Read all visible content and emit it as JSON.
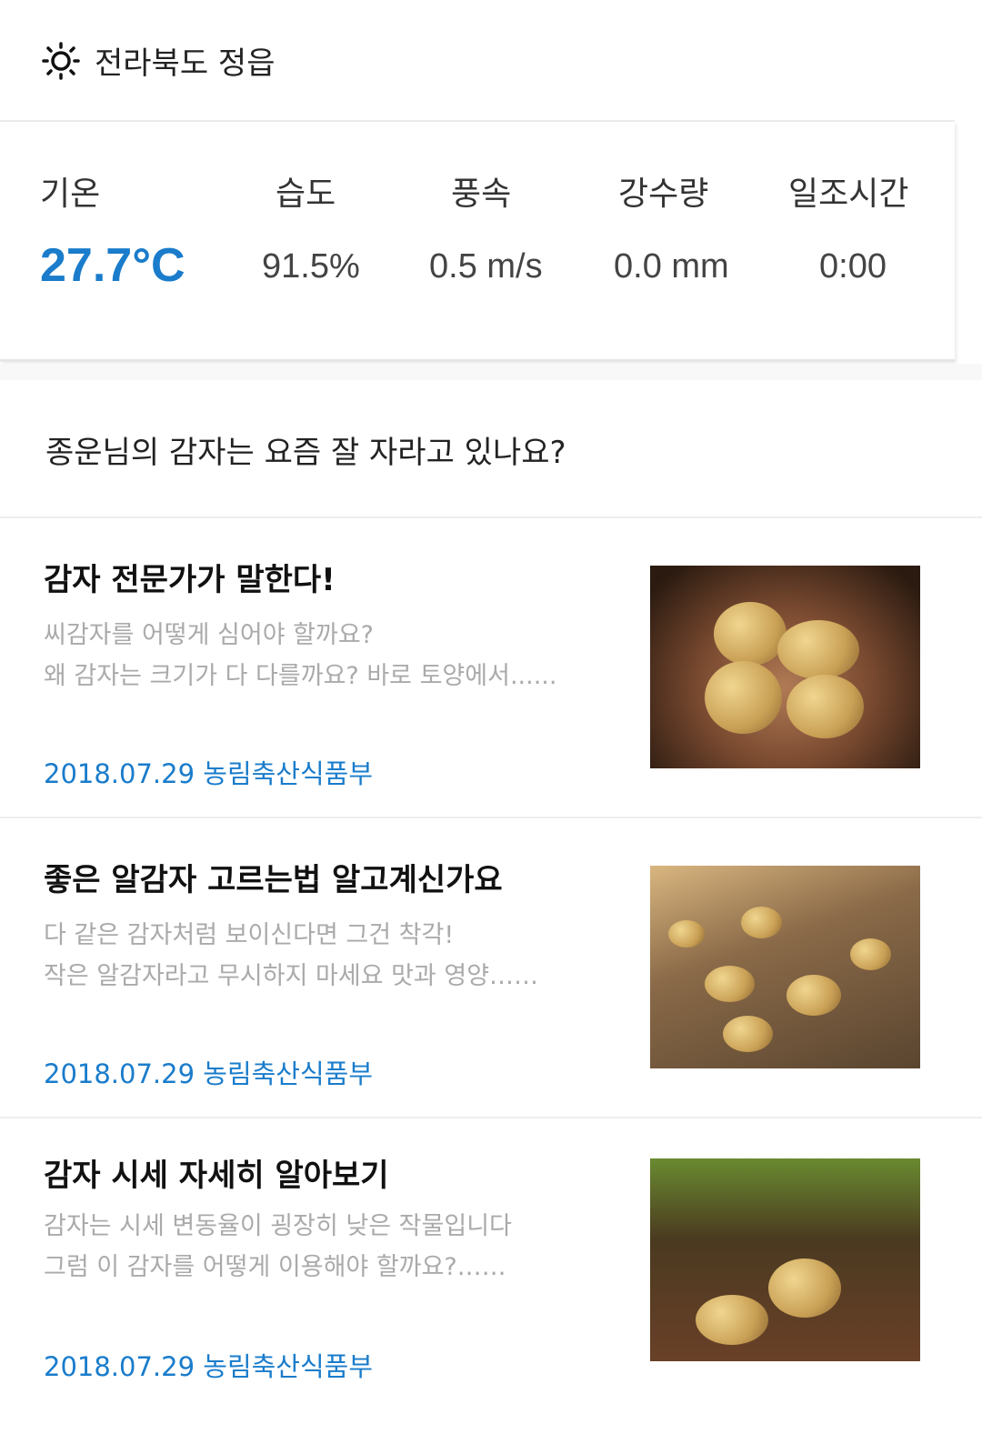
{
  "header": {
    "icon": "sun-icon",
    "location": "전라북도 정읍"
  },
  "weather": [
    {
      "label": "기온",
      "value": "27.7°C"
    },
    {
      "label": "습도",
      "value": "91.5%"
    },
    {
      "label": "풍속",
      "value": "0.5 m/s"
    },
    {
      "label": "강수량",
      "value": "0.0 mm"
    },
    {
      "label": "일조시간",
      "value": "0:00"
    }
  ],
  "question": "종운님의 감자는 요즘 잘 자라고 있나요?",
  "articles": [
    {
      "title": "감자 전문가가 말한다!",
      "line1": "씨감자를 어떻게 심어야 할까요?",
      "line2": "왜 감자는 크기가 다 다를까요? 바로 토양에서......",
      "meta": "2018.07.29 농림축산식품부"
    },
    {
      "title": "좋은 알감자 고르는법 알고계신가요",
      "line1": "다 같은 감자처럼 보이신다면 그건 착각!",
      "line2": "작은 알감자라고 무시하지 마세요 맛과 영양……",
      "meta": "2018.07.29 농림축산식품부"
    },
    {
      "title": "감자 시세 자세히 알아보기",
      "line1": "감자는 시세 변동율이 굉장히 낮은 작물입니다",
      "line2": "그럼 이 감자를 어떻게 이용해야 할까요?……",
      "meta": "2018.07.29 농림축산식품부"
    }
  ],
  "colors": {
    "accent": "#1a7ccb"
  }
}
